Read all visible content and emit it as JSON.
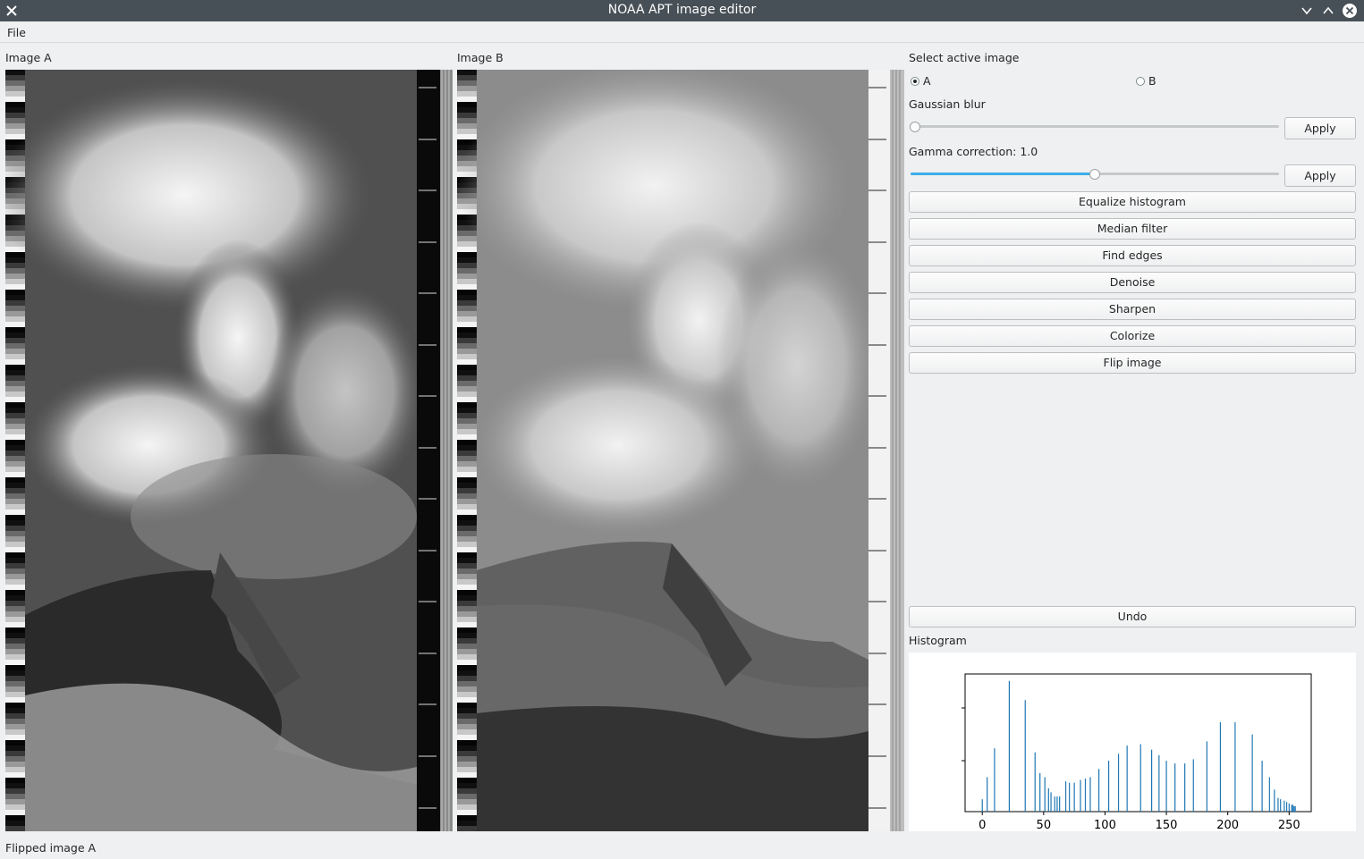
{
  "window": {
    "title": "NOAA APT image editor"
  },
  "menu": {
    "file": "File"
  },
  "images": {
    "a_label": "Image A",
    "b_label": "Image B"
  },
  "controls": {
    "select_label": "Select active image",
    "radio_a": "A",
    "radio_b": "B",
    "selected": "A",
    "blur_label": "Gaussian blur",
    "blur_value": 0,
    "gamma_label": "Gamma correction: 1.0",
    "gamma_fraction": 0.5,
    "apply": "Apply",
    "buttons": [
      "Equalize histogram",
      "Median filter",
      "Find edges",
      "Denoise",
      "Sharpen",
      "Colorize",
      "Flip image"
    ],
    "undo": "Undo",
    "histogram_label": "Histogram"
  },
  "status": "Flipped image A",
  "chart_data": {
    "type": "bar",
    "xlim": [
      -14,
      268
    ],
    "ylim": [
      0,
      1
    ],
    "x_ticks": [
      0,
      50,
      100,
      150,
      200,
      250
    ],
    "x": [
      0,
      4,
      10,
      22,
      35,
      43,
      47,
      51,
      54,
      56,
      59,
      61,
      63,
      68,
      71,
      75,
      80,
      84,
      88,
      95,
      103,
      111,
      118,
      129,
      138,
      144,
      150,
      157,
      165,
      172,
      183,
      194,
      206,
      220,
      228,
      234,
      238,
      241,
      243,
      246,
      248,
      250,
      252,
      253,
      254,
      255
    ],
    "values": [
      0.09,
      0.25,
      0.46,
      0.95,
      0.81,
      0.43,
      0.28,
      0.25,
      0.17,
      0.14,
      0.11,
      0.11,
      0.11,
      0.22,
      0.21,
      0.21,
      0.23,
      0.24,
      0.25,
      0.31,
      0.37,
      0.42,
      0.48,
      0.49,
      0.45,
      0.41,
      0.37,
      0.35,
      0.35,
      0.38,
      0.51,
      0.65,
      0.65,
      0.56,
      0.37,
      0.25,
      0.16,
      0.1,
      0.09,
      0.08,
      0.07,
      0.06,
      0.05,
      0.05,
      0.04,
      0.04
    ]
  }
}
